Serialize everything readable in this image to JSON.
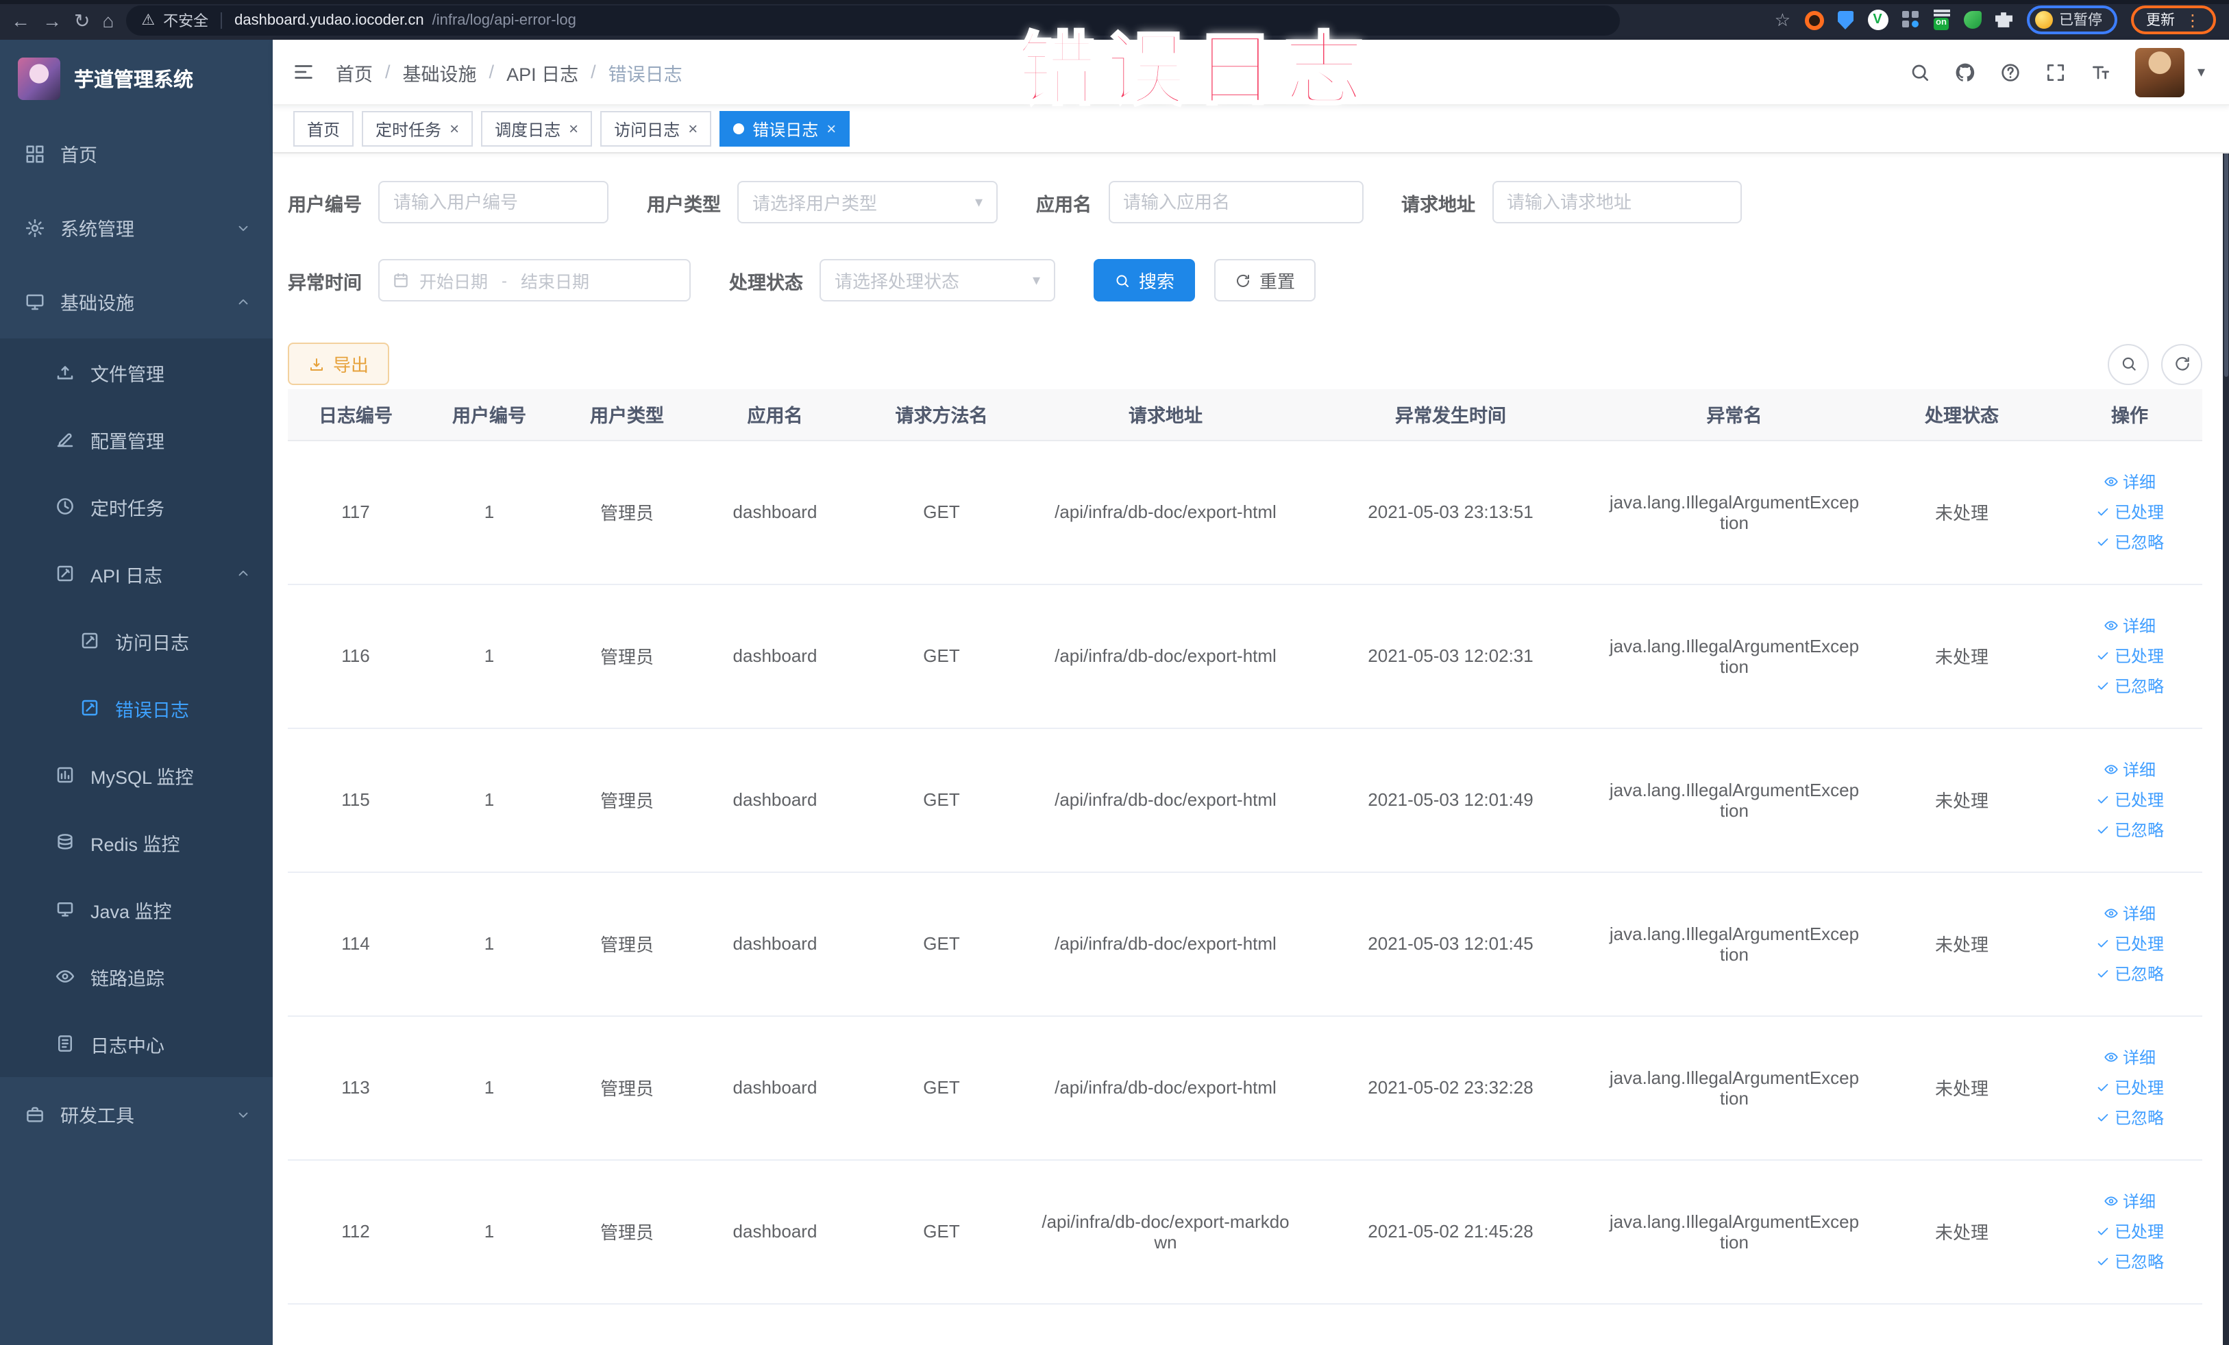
{
  "browser": {
    "security_label": "不安全",
    "url_domain": "dashboard.yudao.iocoder.cn",
    "url_path": "/infra/log/api-error-log",
    "paused_badge_label": "已暂停",
    "update_badge_label": "更新"
  },
  "icons": {
    "back": "←",
    "forward": "→",
    "reload": "↻",
    "home": "⌂",
    "star": "☆",
    "warning": "⚠",
    "menu_dots": "⋮",
    "caret_down": "▾",
    "close": "×",
    "ext_v": "V",
    "ext_on": "on"
  },
  "watermark": "错误日志",
  "sidebar": {
    "logo_title": "芋道管理系统",
    "items": [
      {
        "label": "首页",
        "icon": "dashboard",
        "level": 1
      },
      {
        "label": "系统管理",
        "icon": "gear",
        "level": 1,
        "chevron": "down"
      },
      {
        "label": "基础设施",
        "icon": "monitor",
        "level": 1,
        "chevron": "up"
      },
      {
        "label": "文件管理",
        "icon": "upload",
        "level": 2
      },
      {
        "label": "配置管理",
        "icon": "edit",
        "level": 2
      },
      {
        "label": "定时任务",
        "icon": "clock",
        "level": 2
      },
      {
        "label": "API 日志",
        "icon": "apilog",
        "level": 2,
        "chevron": "up"
      },
      {
        "label": "访问日志",
        "icon": "apilog",
        "level": 3
      },
      {
        "label": "错误日志",
        "icon": "apilog",
        "level": 3,
        "active": true
      },
      {
        "label": "MySQL 监控",
        "icon": "mysql",
        "level": 2
      },
      {
        "label": "Redis 监控",
        "icon": "redis",
        "level": 2
      },
      {
        "label": "Java 监控",
        "icon": "java",
        "level": 2
      },
      {
        "label": "链路追踪",
        "icon": "eye",
        "level": 2
      },
      {
        "label": "日志中心",
        "icon": "logcenter",
        "level": 2
      },
      {
        "label": "研发工具",
        "icon": "briefcase",
        "level": 1,
        "chevron": "down"
      }
    ]
  },
  "breadcrumb": {
    "items": [
      "首页",
      "基础设施",
      "API 日志",
      "错误日志"
    ],
    "separator": "/"
  },
  "tabs": [
    {
      "label": "首页",
      "closable": false,
      "active": false
    },
    {
      "label": "定时任务",
      "closable": true,
      "active": false
    },
    {
      "label": "调度日志",
      "closable": true,
      "active": false
    },
    {
      "label": "访问日志",
      "closable": true,
      "active": false
    },
    {
      "label": "错误日志",
      "closable": true,
      "active": true
    }
  ],
  "filters": {
    "user_id_label": "用户编号",
    "user_id_placeholder": "请输入用户编号",
    "user_type_label": "用户类型",
    "user_type_placeholder": "请选择用户类型",
    "app_name_label": "应用名",
    "app_name_placeholder": "请输入应用名",
    "request_url_label": "请求地址",
    "request_url_placeholder": "请输入请求地址",
    "exception_time_label": "异常时间",
    "start_date_placeholder": "开始日期",
    "range_separator": "-",
    "end_date_placeholder": "结束日期",
    "process_status_label": "处理状态",
    "process_status_placeholder": "请选择处理状态",
    "search_label": "搜索",
    "reset_label": "重置"
  },
  "toolbar": {
    "export_label": "导出"
  },
  "table": {
    "columns": [
      "日志编号",
      "用户编号",
      "用户类型",
      "应用名",
      "请求方法名",
      "请求地址",
      "异常发生时间",
      "异常名",
      "处理状态",
      "操作"
    ],
    "actions": [
      {
        "icon": "eye",
        "label": "详细"
      },
      {
        "icon": "check",
        "label": "已处理"
      },
      {
        "icon": "check",
        "label": "已忽略"
      }
    ],
    "rows": [
      {
        "id": "117",
        "user_id": "1",
        "user_type": "管理员",
        "app_name": "dashboard",
        "method": "GET",
        "url": "/api/infra/db-doc/export-html",
        "time": "2021-05-03 23:13:51",
        "exception": "java.lang.IllegalArgumentException",
        "status": "未处理"
      },
      {
        "id": "116",
        "user_id": "1",
        "user_type": "管理员",
        "app_name": "dashboard",
        "method": "GET",
        "url": "/api/infra/db-doc/export-html",
        "time": "2021-05-03 12:02:31",
        "exception": "java.lang.IllegalArgumentException",
        "status": "未处理"
      },
      {
        "id": "115",
        "user_id": "1",
        "user_type": "管理员",
        "app_name": "dashboard",
        "method": "GET",
        "url": "/api/infra/db-doc/export-html",
        "time": "2021-05-03 12:01:49",
        "exception": "java.lang.IllegalArgumentException",
        "status": "未处理"
      },
      {
        "id": "114",
        "user_id": "1",
        "user_type": "管理员",
        "app_name": "dashboard",
        "method": "GET",
        "url": "/api/infra/db-doc/export-html",
        "time": "2021-05-03 12:01:45",
        "exception": "java.lang.IllegalArgumentException",
        "status": "未处理"
      },
      {
        "id": "113",
        "user_id": "1",
        "user_type": "管理员",
        "app_name": "dashboard",
        "method": "GET",
        "url": "/api/infra/db-doc/export-html",
        "time": "2021-05-02 23:32:28",
        "exception": "java.lang.IllegalArgumentException",
        "status": "未处理"
      },
      {
        "id": "112",
        "user_id": "1",
        "user_type": "管理员",
        "app_name": "dashboard",
        "method": "GET",
        "url": "/api/infra/db-doc/export-markdown",
        "time": "2021-05-02 21:45:28",
        "exception": "java.lang.IllegalArgumentException",
        "status": "未处理"
      }
    ]
  },
  "colors": {
    "accent": "#1e87e8",
    "link": "#409eff",
    "warning": "#e6a23c",
    "sidebar_bg": "#2e455f",
    "submenu_bg": "#273c54",
    "watermark": "#f5395f"
  }
}
